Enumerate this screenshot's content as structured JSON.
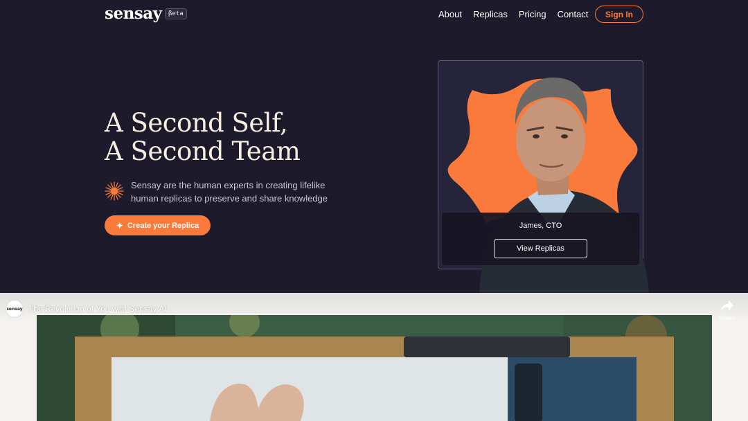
{
  "nav": {
    "logo": "sensay",
    "beta": "βeta",
    "links": [
      "About",
      "Replicas",
      "Pricing",
      "Contact"
    ],
    "signin": "Sign In"
  },
  "hero": {
    "title_line1": "A Second Self,",
    "title_line2": "A Second Team",
    "description": "Sensay are the human experts in creating lifelike human replicas to preserve and share knowledge",
    "cta": "Create your Replica"
  },
  "card": {
    "name": "James, CTO",
    "button": "View Replicas"
  },
  "video": {
    "channel": "sensay",
    "title": "The Revolution of You with Sensay AI",
    "share": "Share"
  },
  "colors": {
    "background": "#1d1b2b",
    "accent": "#f97a3a",
    "title": "#f7eee2"
  },
  "icons": {
    "cta": "sparkle-icon",
    "hero": "sun-burst-icon",
    "share": "share-arrow-icon"
  }
}
